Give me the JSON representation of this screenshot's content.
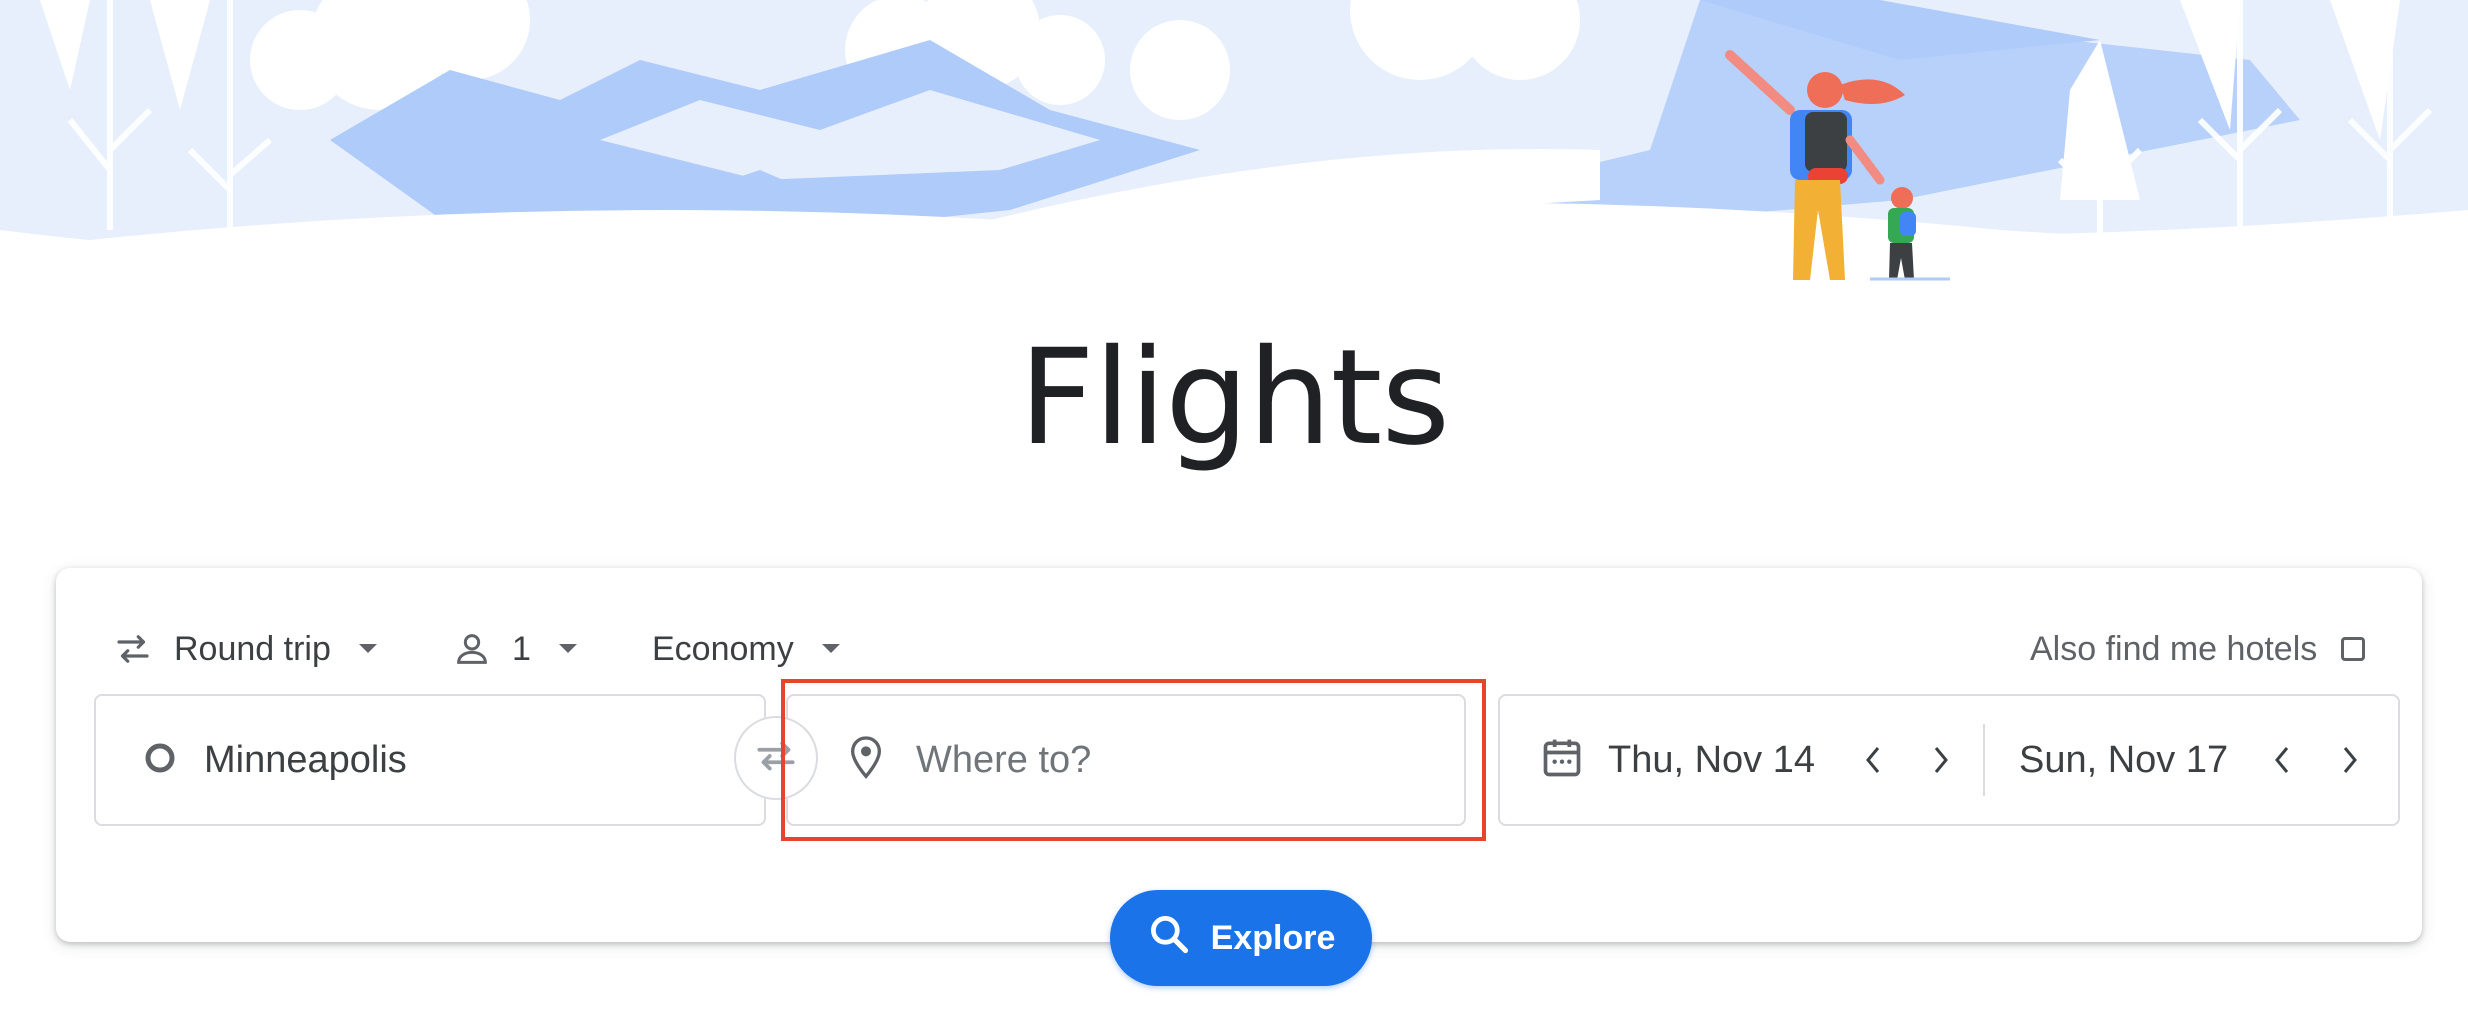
{
  "page": {
    "title": "Flights"
  },
  "options": {
    "trip_type": "Round trip",
    "passengers": "1",
    "cabin_class": "Economy",
    "hotels_label": "Also find me hotels",
    "hotels_checked": false
  },
  "search": {
    "origin": "Minneapolis",
    "destination_placeholder": "Where to?",
    "depart_date": "Thu, Nov 14",
    "return_date": "Sun, Nov 17"
  },
  "actions": {
    "explore_label": "Explore"
  },
  "colors": {
    "accent": "#1a73e8",
    "highlight": "#e8432d",
    "hero_light": "#e8effc",
    "hero_mid": "#aecbfa"
  }
}
